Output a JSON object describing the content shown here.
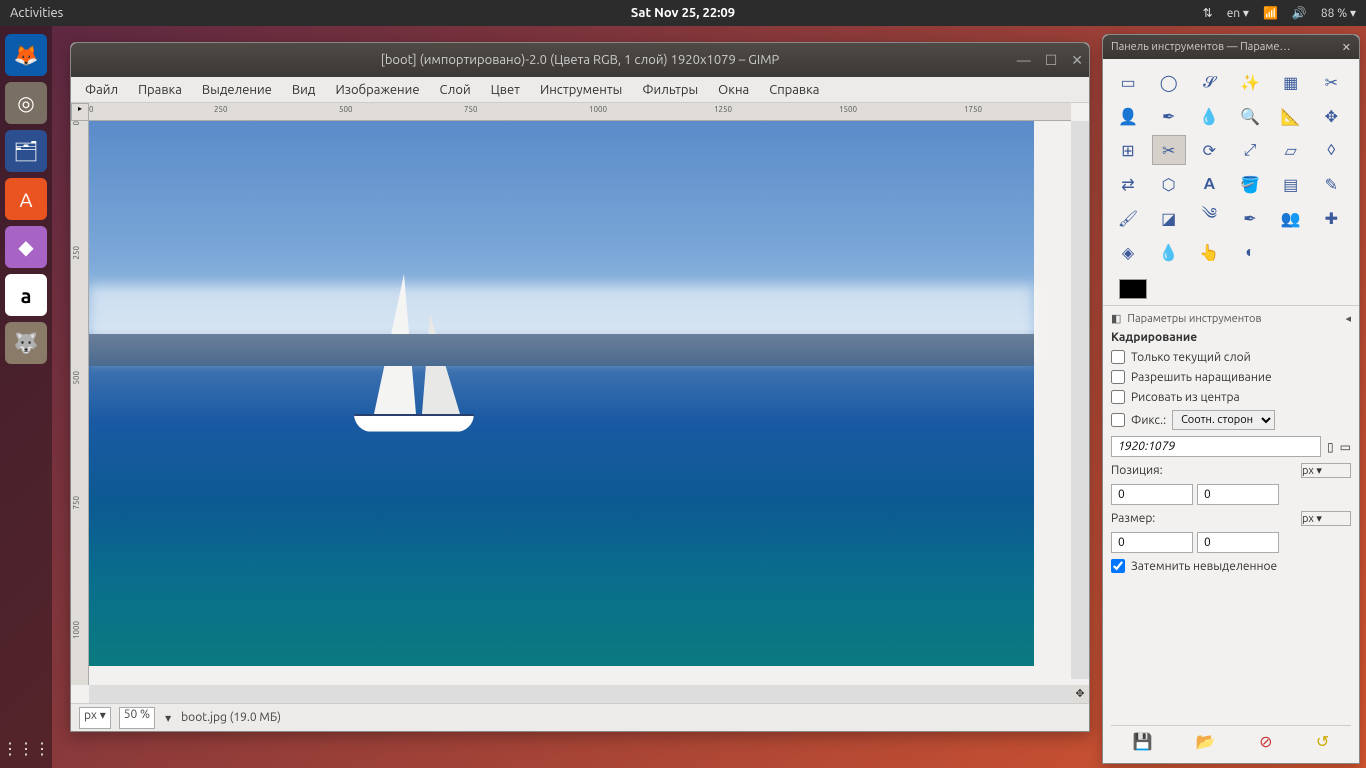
{
  "topbar": {
    "activities": "Activities",
    "datetime": "Sat Nov 25, 22:09",
    "lang": "en ▾",
    "battery": "88 % ▾"
  },
  "launcher": {
    "apps": [
      "firefox",
      "disks",
      "files",
      "software",
      "amazon-icon",
      "amazon",
      "gimp"
    ]
  },
  "gimp": {
    "title": "[boot] (импортировано)-2.0 (Цвета RGB, 1 слой) 1920x1079 – GIMP",
    "menu": [
      "Файл",
      "Правка",
      "Выделение",
      "Вид",
      "Изображение",
      "Слой",
      "Цвет",
      "Инструменты",
      "Фильтры",
      "Окна",
      "Справка"
    ],
    "ruler_h": [
      "0",
      "250",
      "500",
      "750",
      "1000",
      "1250",
      "1500",
      "1750"
    ],
    "ruler_v": [
      "0",
      "250",
      "500",
      "750",
      "1000"
    ],
    "status": {
      "unit": "px ▾",
      "zoom": "50 %",
      "file": "boot.jpg (19.0 МБ)"
    }
  },
  "toolbox": {
    "title": "Панель инструментов — Параме…",
    "tools": [
      "rect-select",
      "ellipse-select",
      "free-select",
      "fuzzy-select",
      "by-color-select",
      "scissors",
      "foreground-select",
      "paths",
      "color-picker",
      "zoom",
      "measure",
      "move",
      "align",
      "crop",
      "rotate",
      "scale",
      "shear",
      "perspective",
      "flip",
      "cage",
      "text",
      "bucket-fill",
      "blend",
      "pencil",
      "paintbrush",
      "eraser",
      "airbrush",
      "ink",
      "clone",
      "heal",
      "perspective-clone",
      "blur",
      "smudge",
      "dodge"
    ],
    "options_header": "Параметры инструментов",
    "crop": {
      "title": "Кадрирование",
      "only_layer": "Только текущий слой",
      "allow_growing": "Разрешить наращивание",
      "from_center": "Рисовать из центра",
      "fixed_label": "Фикс.:",
      "fixed_mode": "Соотн. сторон",
      "ratio_value": "1920:1079",
      "position_label": "Позиция:",
      "position_unit": "px ▾",
      "pos_x": "0",
      "pos_y": "0",
      "size_label": "Размер:",
      "size_unit": "px ▾",
      "size_w": "0",
      "size_h": "0",
      "darken": "Затемнить невыделенное"
    }
  }
}
